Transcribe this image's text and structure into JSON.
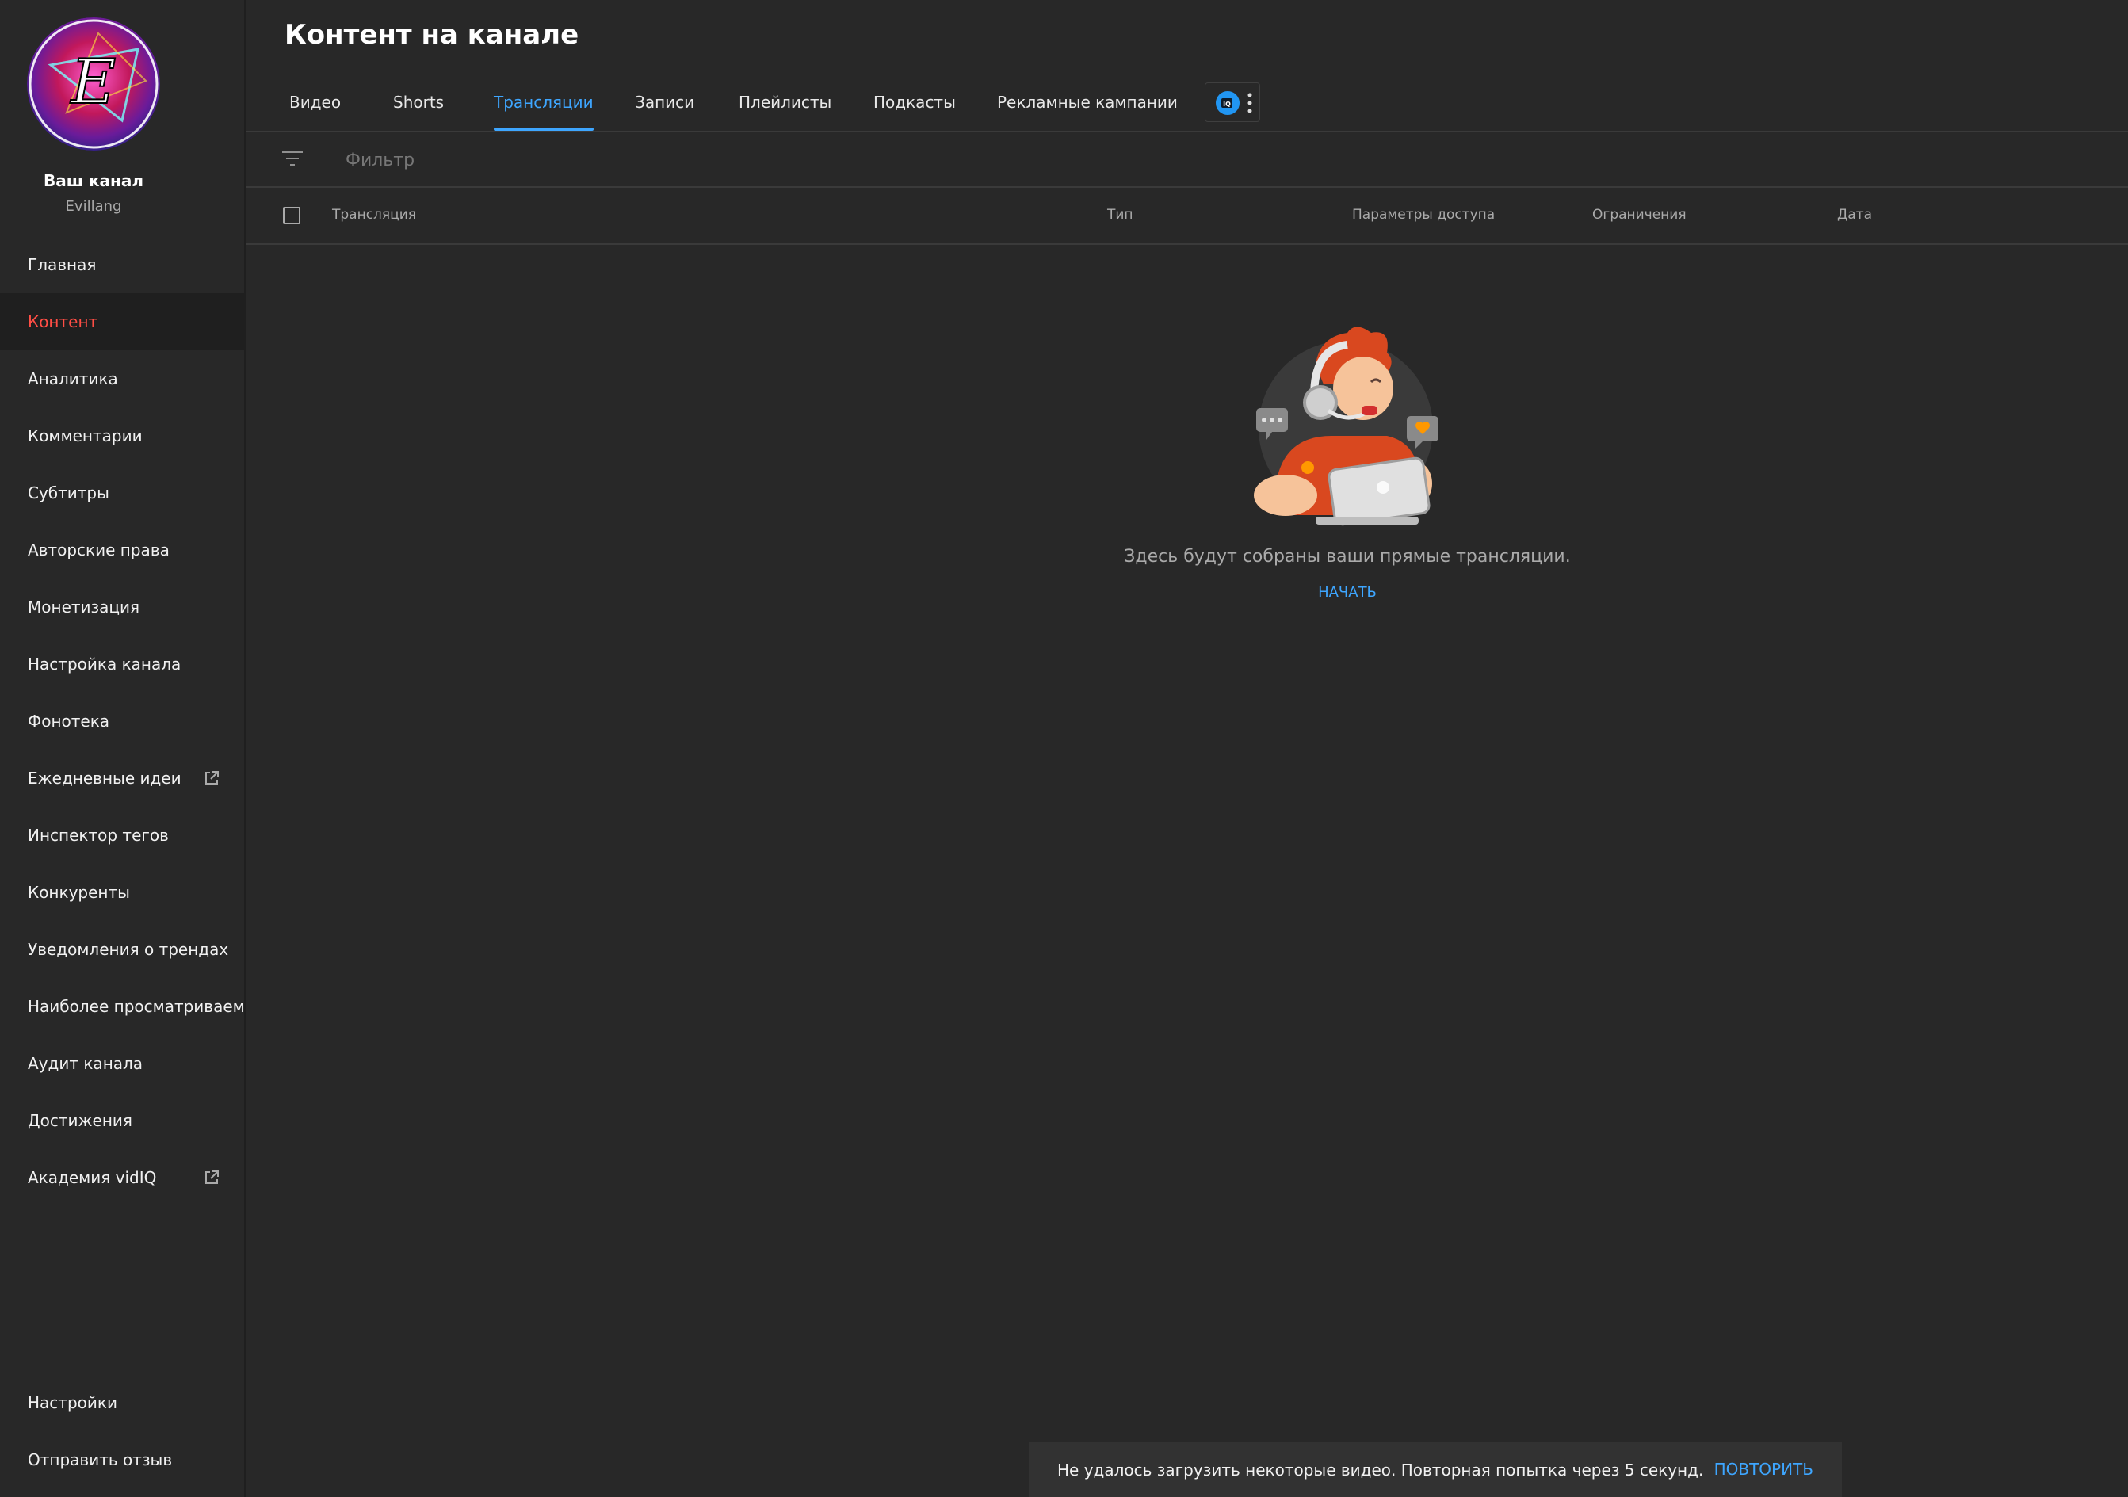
{
  "channel": {
    "title": "Ваш канал",
    "handle": "Evillang"
  },
  "nav": {
    "items": [
      {
        "label": "Главная"
      },
      {
        "label": "Контент",
        "active": true
      },
      {
        "label": "Аналитика"
      },
      {
        "label": "Комментарии"
      },
      {
        "label": "Субтитры"
      },
      {
        "label": "Авторские права"
      },
      {
        "label": "Монетизация"
      },
      {
        "label": "Настройка канала"
      },
      {
        "label": "Фонотека"
      },
      {
        "label": "Ежедневные идеи",
        "external": true
      },
      {
        "label": "Инспектор тегов"
      },
      {
        "label": "Конкуренты"
      },
      {
        "label": "Уведомления о трендах"
      },
      {
        "label": "Наиболее просматриваемое"
      },
      {
        "label": "Аудит канала"
      },
      {
        "label": "Достижения"
      },
      {
        "label": "Академия vidIQ",
        "external": true
      }
    ],
    "bottom_items": [
      {
        "label": "Настройки"
      },
      {
        "label": "Отправить отзыв"
      }
    ]
  },
  "page": {
    "title": "Контент на канале"
  },
  "tabs": [
    {
      "label": "Видео"
    },
    {
      "label": "Shorts"
    },
    {
      "label": "Трансляции",
      "active": true
    },
    {
      "label": "Записи"
    },
    {
      "label": "Плейлисты"
    },
    {
      "label": "Подкасты"
    },
    {
      "label": "Рекламные кампании"
    }
  ],
  "filter": {
    "placeholder": "Фильтр"
  },
  "table": {
    "columns": [
      "Трансляция",
      "Тип",
      "Параметры доступа",
      "Ограничения",
      "Дата"
    ]
  },
  "empty_state": {
    "message": "Здесь будут собраны ваши прямые трансляции.",
    "action": "НАЧАТЬ"
  },
  "snackbar": {
    "message": "Не удалось загрузить некоторые видео. Повторная попытка через 5 секунд.",
    "action": "ПОВТОРИТЬ"
  },
  "colors": {
    "background": "#282828",
    "accent_active_nav": "#ff4e45",
    "accent_link": "#3ea6ff"
  },
  "icons": [
    "channel-avatar",
    "external-link-icon",
    "vidiq-icon",
    "more-vert-icon",
    "filter-icon",
    "checkbox"
  ]
}
